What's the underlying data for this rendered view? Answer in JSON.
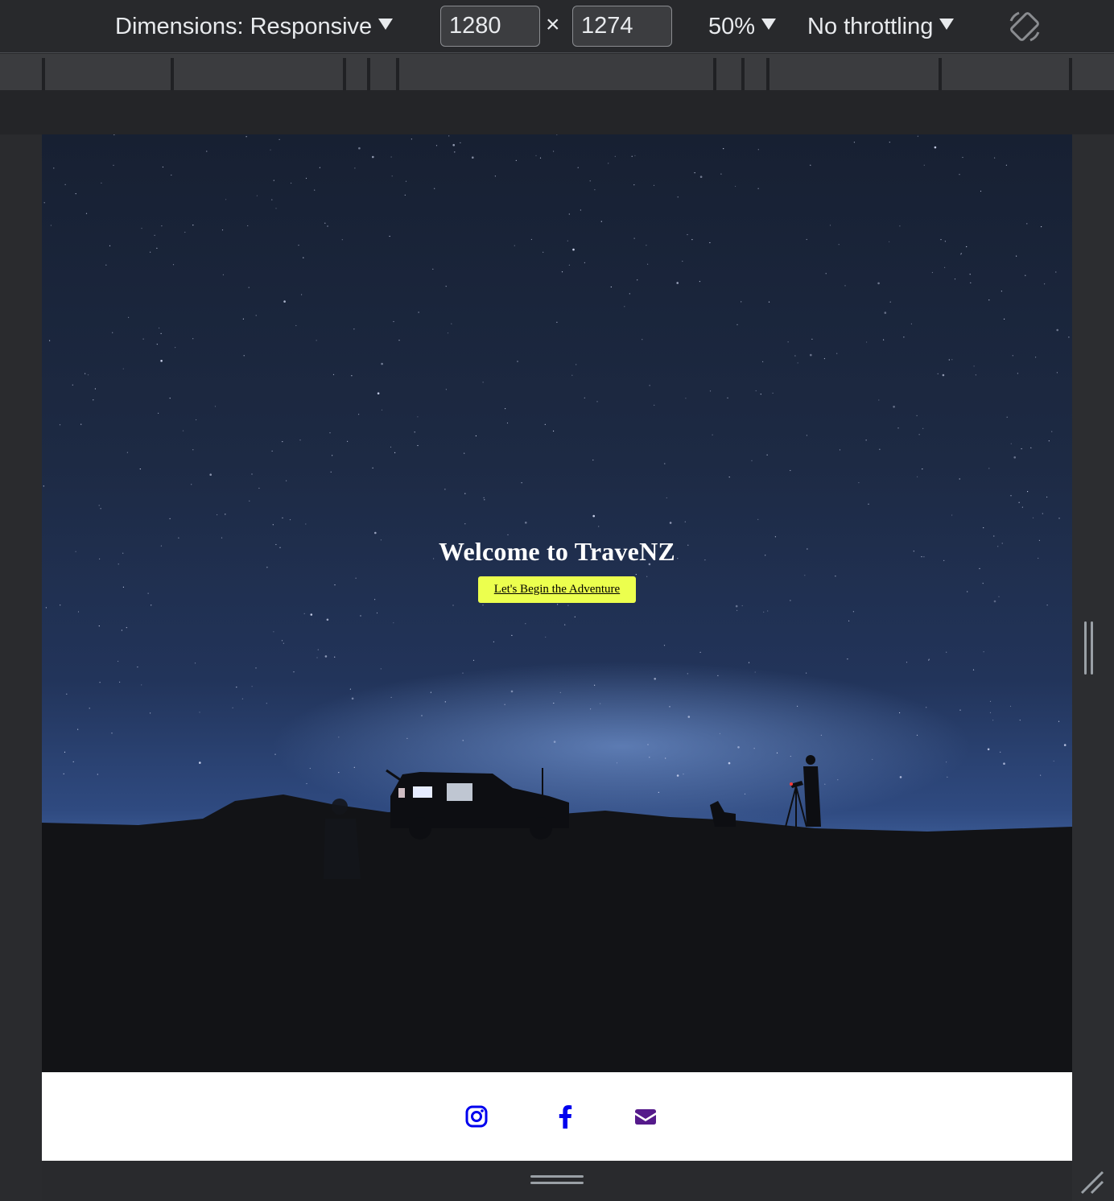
{
  "devtools": {
    "dimensions_label": "Dimensions: Responsive",
    "width_value": "1280",
    "height_value": "1274",
    "times_symbol": "×",
    "zoom_label": "50%",
    "throttling_label": "No throttling",
    "rotate_icon": "rotate-icon"
  },
  "page": {
    "hero": {
      "title": "Welcome to TraveNZ",
      "cta_label": "Let's Begin the Adventure"
    },
    "footer": {
      "icons": [
        {
          "name": "instagram-icon",
          "color": "#0000ee"
        },
        {
          "name": "facebook-icon",
          "color": "#0000ee"
        },
        {
          "name": "envelope-icon",
          "color": "#551a8b"
        }
      ]
    }
  },
  "colors": {
    "cta_background": "#ecff4e",
    "link": "#0000ee",
    "visited_link": "#551a8b",
    "toolbar_background": "#28292c"
  }
}
